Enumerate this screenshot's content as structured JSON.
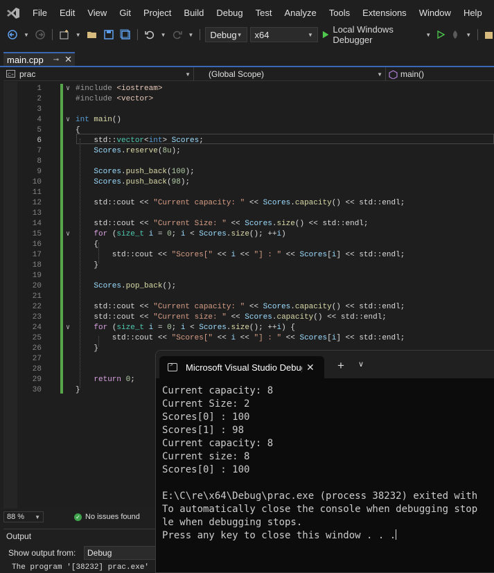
{
  "menu": [
    "File",
    "Edit",
    "View",
    "Git",
    "Project",
    "Build",
    "Debug",
    "Test",
    "Analyze",
    "Tools",
    "Extensions",
    "Window",
    "Help"
  ],
  "toolbar": {
    "configuration": "Debug",
    "platform": "x64",
    "run_label": "Local Windows Debugger"
  },
  "tab": {
    "filename": "main.cpp"
  },
  "navbar": {
    "project": "prac",
    "scope": "(Global Scope)",
    "member": "main()"
  },
  "editor": {
    "current_line": 6,
    "lines": [
      {
        "n": "1",
        "fold": "v",
        "html": "<span class=\"pp\">#include</span> <span class=\"inc\">&lt;iostream&gt;</span>"
      },
      {
        "n": "2",
        "fold": "",
        "html": "<span class=\"pp\">#include</span> <span class=\"inc\">&lt;vector&gt;</span>"
      },
      {
        "n": "3",
        "fold": "",
        "html": ""
      },
      {
        "n": "4",
        "fold": "v",
        "html": "<span class=\"kw\">int</span> <span class=\"fn\">main</span>()"
      },
      {
        "n": "5",
        "fold": "",
        "html": "{"
      },
      {
        "n": "6",
        "fold": "",
        "html": "    std::<span class=\"ty\">vector</span>&lt;<span class=\"kw\">int</span>&gt; <span class=\"var\">Scores</span>;"
      },
      {
        "n": "7",
        "fold": "",
        "html": "    <span class=\"var\">Scores</span>.<span class=\"fn\">reserve</span>(<span class=\"num\">8u</span>);"
      },
      {
        "n": "8",
        "fold": "",
        "html": ""
      },
      {
        "n": "9",
        "fold": "",
        "html": "    <span class=\"var\">Scores</span>.<span class=\"fn\">push_back</span>(<span class=\"num\">100</span>);"
      },
      {
        "n": "10",
        "fold": "",
        "html": "    <span class=\"var\">Scores</span>.<span class=\"fn\">push_back</span>(<span class=\"num\">98</span>);"
      },
      {
        "n": "11",
        "fold": "",
        "html": ""
      },
      {
        "n": "12",
        "fold": "",
        "html": "    std::cout &lt;&lt; <span class=\"str\">\"Current capacity: \"</span> &lt;&lt; <span class=\"var\">Scores</span>.<span class=\"fn\">capacity</span>() &lt;&lt; std::endl;"
      },
      {
        "n": "13",
        "fold": "",
        "html": ""
      },
      {
        "n": "14",
        "fold": "",
        "html": "    std::cout &lt;&lt; <span class=\"str\">\"Current Size: \"</span> &lt;&lt; <span class=\"var\">Scores</span>.<span class=\"fn\">size</span>() &lt;&lt; std::endl;"
      },
      {
        "n": "15",
        "fold": "v",
        "html": "    <span class=\"ctrl\">for</span> (<span class=\"ty\">size_t</span> <span class=\"var\">i</span> = <span class=\"num\">0</span>; <span class=\"var\">i</span> &lt; <span class=\"var\">Scores</span>.<span class=\"fn\">size</span>(); ++<span class=\"var\">i</span>)"
      },
      {
        "n": "16",
        "fold": "",
        "html": "    {"
      },
      {
        "n": "17",
        "fold": "",
        "html": "        std::cout &lt;&lt; <span class=\"str\">\"Scores[\"</span> &lt;&lt; <span class=\"var\">i</span> &lt;&lt; <span class=\"str\">\"] : \"</span> &lt;&lt; <span class=\"var\">Scores</span>[<span class=\"var\">i</span>] &lt;&lt; std::endl;"
      },
      {
        "n": "18",
        "fold": "",
        "html": "    }"
      },
      {
        "n": "19",
        "fold": "",
        "html": ""
      },
      {
        "n": "20",
        "fold": "",
        "html": "    <span class=\"var\">Scores</span>.<span class=\"fn\">pop_back</span>();"
      },
      {
        "n": "21",
        "fold": "",
        "html": ""
      },
      {
        "n": "22",
        "fold": "",
        "html": "    std::cout &lt;&lt; <span class=\"str\">\"Current capacity: \"</span> &lt;&lt; <span class=\"var\">Scores</span>.<span class=\"fn\">capacity</span>() &lt;&lt; std::endl;"
      },
      {
        "n": "23",
        "fold": "",
        "html": "    std::cout &lt;&lt; <span class=\"str\">\"Current size: \"</span> &lt;&lt; <span class=\"var\">Scores</span>.<span class=\"fn\">capacity</span>() &lt;&lt; std::endl;"
      },
      {
        "n": "24",
        "fold": "v",
        "html": "    <span class=\"ctrl\">for</span> (<span class=\"ty\">size_t</span> <span class=\"var\">i</span> = <span class=\"num\">0</span>; <span class=\"var\">i</span> &lt; <span class=\"var\">Scores</span>.<span class=\"fn\">size</span>(); ++<span class=\"var\">i</span>) {"
      },
      {
        "n": "25",
        "fold": "",
        "html": "        std::cout &lt;&lt; <span class=\"str\">\"Scores[\"</span> &lt;&lt; <span class=\"var\">i</span> &lt;&lt; <span class=\"str\">\"] : \"</span> &lt;&lt; <span class=\"var\">Scores</span>[<span class=\"var\">i</span>] &lt;&lt; std::endl;"
      },
      {
        "n": "26",
        "fold": "",
        "html": "    }"
      },
      {
        "n": "27",
        "fold": "",
        "html": ""
      },
      {
        "n": "28",
        "fold": "",
        "html": ""
      },
      {
        "n": "29",
        "fold": "",
        "html": "    <span class=\"ctrl\">return</span> <span class=\"num\">0</span>;"
      },
      {
        "n": "30",
        "fold": "",
        "html": "}"
      }
    ]
  },
  "status": {
    "zoom": "88 %",
    "issues": "No issues found"
  },
  "output": {
    "title": "Output",
    "show_from_label": "Show output from:",
    "source": "Debug",
    "line": "The program '[38232] prac.exe'"
  },
  "terminal": {
    "tab_title": "Microsoft Visual Studio Debug",
    "lines": [
      "Current capacity: 8",
      "Current Size: 2",
      "Scores[0] : 100",
      "Scores[1] : 98",
      "Current capacity: 8",
      "Current size: 8",
      "Scores[0] : 100",
      "",
      "E:\\C\\re\\x64\\Debug\\prac.exe (process 38232) exited with",
      "To automatically close the console when debugging stop",
      "le when debugging stops.",
      "Press any key to close this window . . ."
    ]
  },
  "colors": {
    "accent": "#3b68b4",
    "change_bar": "#57a64a",
    "run_green": "#4ec94e"
  }
}
